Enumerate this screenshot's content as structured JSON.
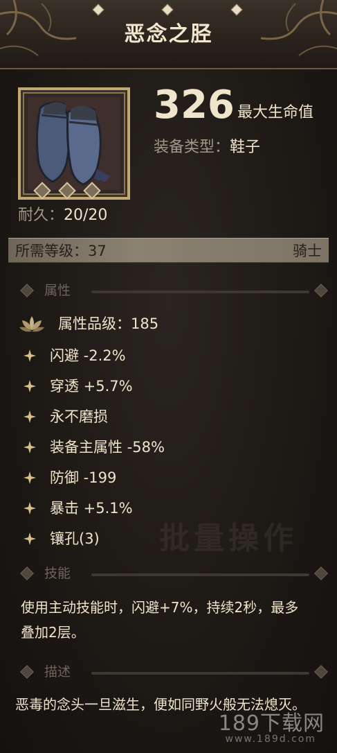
{
  "item": {
    "name": "恶念之胫",
    "stat_value": "326",
    "stat_label": "最大生命值",
    "equip_type_label": "装备类型：",
    "equip_type_value": "鞋子",
    "durability_label": "耐久：",
    "durability_value": "20/20",
    "required_level": "所需等级：37",
    "class": "骑士",
    "socket_gems_count": 3
  },
  "sections": {
    "attributes": "属性",
    "skill": "技能",
    "description": "描述"
  },
  "grade": "属性品级：185",
  "attributes": [
    "闪避 -2.2%",
    "穿透 +5.7%",
    "永不磨损",
    "装备主属性 -58%",
    "防御 -199",
    "暴击 +5.1%",
    "镶孔(3)"
  ],
  "skill_text": "使用主动技能时，闪避+7%，持续2秒，最多叠加2层。",
  "description_text": "恶毒的念头一旦滋生，便如同野火般无法熄灭。",
  "background_text": "批量操作",
  "watermark": {
    "main": "189下载网",
    "sub": "www.189d.com"
  },
  "colors": {
    "text": "#efe4cc",
    "muted": "#a09786",
    "gold": "#c2a872"
  }
}
